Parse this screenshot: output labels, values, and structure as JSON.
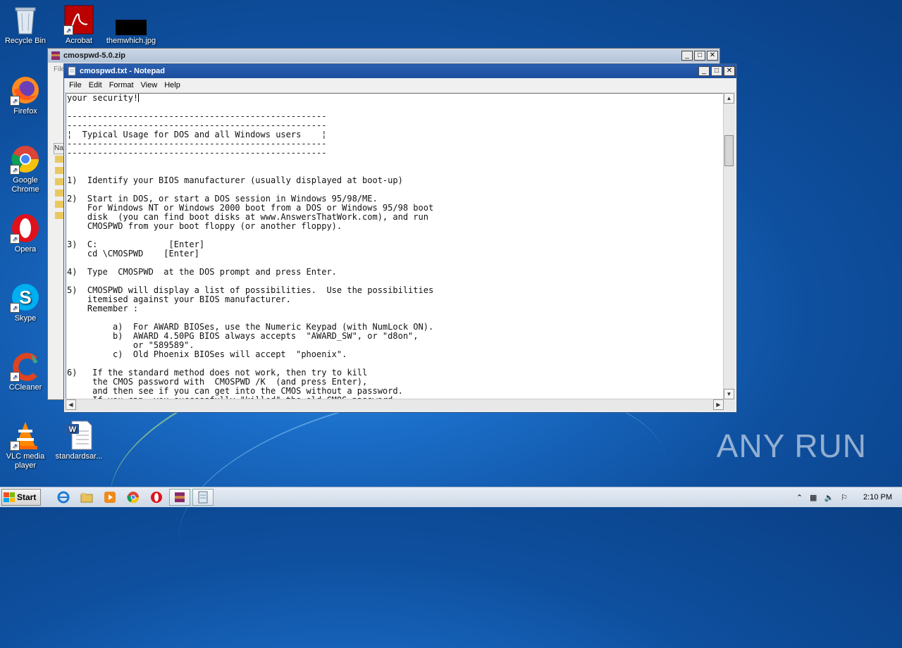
{
  "desktop": {
    "icons": [
      {
        "label": "Recycle Bin",
        "icon": "recycle-bin-icon"
      },
      {
        "label": "Acrobat",
        "icon": "acrobat-icon"
      },
      {
        "label": "themwhich.jpg",
        "icon": "image-file-icon"
      },
      {
        "label": "Firefox",
        "icon": "firefox-icon"
      },
      {
        "label": "Google Chrome",
        "icon": "chrome-icon"
      },
      {
        "label": "Opera",
        "icon": "opera-icon"
      },
      {
        "label": "Skype",
        "icon": "skype-icon"
      },
      {
        "label": "CCleaner",
        "icon": "ccleaner-icon"
      },
      {
        "label": "VLC media player",
        "icon": "vlc-icon"
      },
      {
        "label": "standardsar...",
        "icon": "word-document-icon"
      }
    ]
  },
  "zip_window": {
    "title": "cmospwd-5.0.zip",
    "menu_fragment": "File",
    "col_fragment": "Na"
  },
  "notepad": {
    "title": "cmospwd.txt - Notepad",
    "menu": [
      "File",
      "Edit",
      "Format",
      "View",
      "Help"
    ],
    "lines": [
      "your security!",
      "",
      "---------------------------------------------------",
      "---------------------------------------------------",
      "¦  Typical Usage for DOS and all Windows users    ¦",
      "---------------------------------------------------",
      "---------------------------------------------------",
      "",
      "",
      "1)  Identify your BIOS manufacturer (usually displayed at boot-up)",
      "",
      "2)  Start in DOS, or start a DOS session in Windows 95/98/ME.",
      "    For Windows NT or Windows 2000 boot from a DOS or Windows 95/98 boot",
      "    disk  (you can find boot disks at www.AnswersThatWork.com), and run",
      "    CMOSPWD from your boot floppy (or another floppy).",
      "",
      "3)  C:              [Enter]",
      "    cd \\CMOSPWD    [Enter]",
      "",
      "4)  Type  CMOSPWD  at the DOS prompt and press Enter.",
      "",
      "5)  CMOSPWD will display a list of possibilities.  Use the possibilities",
      "    itemised against your BIOS manufacturer.",
      "    Remember :",
      "",
      "         a)  For AWARD BIOSes, use the Numeric Keypad (with NumLock ON).",
      "         b)  AWARD 4.50PG BIOS always accepts  \"AWARD_SW\", or \"d8on\",",
      "             or \"589589\".",
      "         c)  Old Phoenix BIOSes will accept  \"phoenix\".",
      "",
      "6)   If the standard method does not work, then try to kill",
      "     the CMOS password with  CMOSPWD /K  (and press Enter),",
      "     and then see if you can get into the CMOS without a password.",
      "     If you can, you successfully \"killed\" the old CMOS password."
    ]
  },
  "taskbar": {
    "start_label": "Start",
    "items": [
      "ie-icon",
      "explorer-icon",
      "media-player-icon",
      "chrome-icon",
      "opera-icon",
      "winrar-icon",
      "notepad-icon"
    ],
    "clock": "2:10 PM"
  },
  "watermark": "ANY RUN"
}
